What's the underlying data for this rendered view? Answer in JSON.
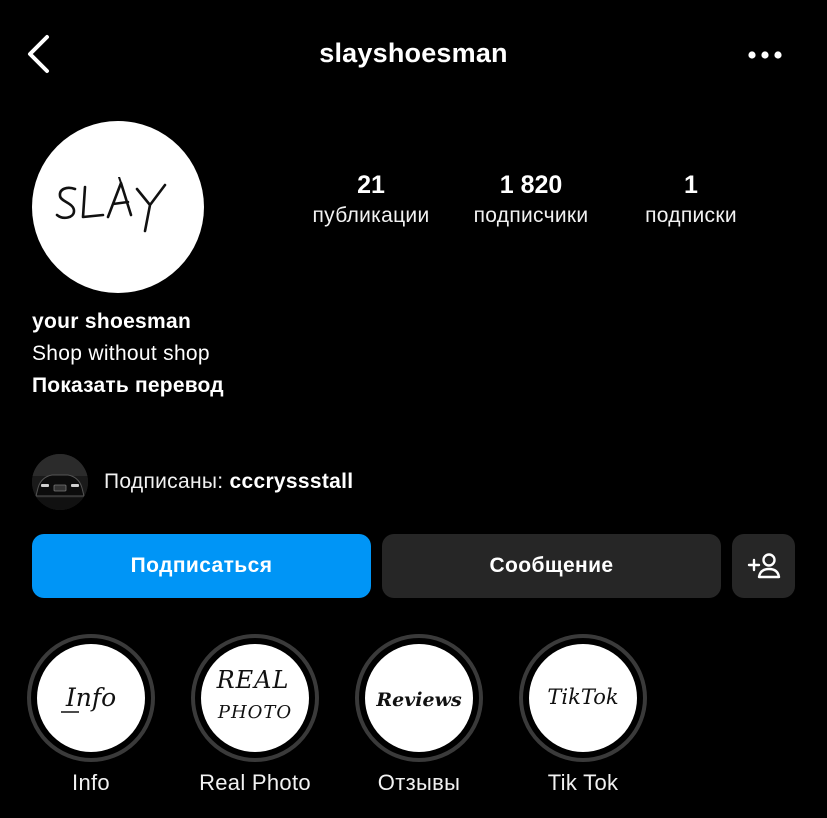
{
  "header": {
    "username": "slayshoesman",
    "back_icon": "chevron-left-icon",
    "more_icon": "ellipsis-icon"
  },
  "profile": {
    "avatar_text": "SLAY",
    "stats": [
      {
        "value": "21",
        "label": "публикации"
      },
      {
        "value": "1 820",
        "label": "подписчики"
      },
      {
        "value": "1",
        "label": "подписки"
      }
    ],
    "bio": {
      "name": "your shoesman",
      "text": "Shop without shop",
      "translate": "Показать перевод"
    },
    "mutual": {
      "prefix": "Подписаны: ",
      "username": "cccryssstall"
    }
  },
  "actions": {
    "follow": "Подписаться",
    "message": "Сообщение",
    "add_user_icon": "add-user-icon"
  },
  "highlights": [
    {
      "label": "Info",
      "cover": [
        "Info"
      ]
    },
    {
      "label": "Real Photo",
      "cover": [
        "REAL",
        "PHOTO"
      ]
    },
    {
      "label": "Отзывы",
      "cover": [
        "Reviews"
      ]
    },
    {
      "label": "Tik Tok",
      "cover": [
        "TikTok"
      ]
    }
  ],
  "colors": {
    "background": "#000000",
    "accent": "#0095f6",
    "secondary_button": "#262626",
    "highlight_ring": "#3a3a3a"
  }
}
